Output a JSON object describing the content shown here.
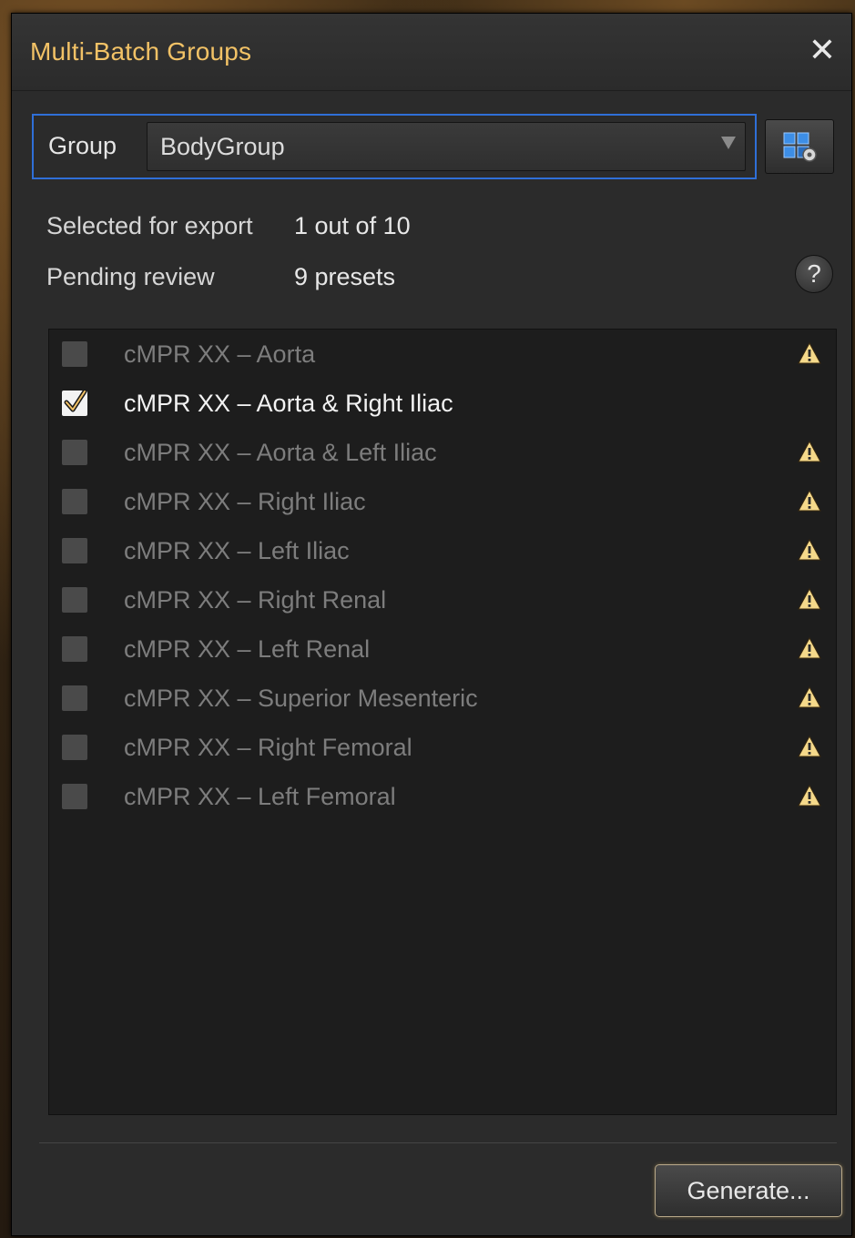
{
  "dialog": {
    "title": "Multi-Batch Groups",
    "close_glyph": "✕"
  },
  "group": {
    "label": "Group",
    "selected": "BodyGroup",
    "settings_icon": "group-settings-icon"
  },
  "info": {
    "selected_label": "Selected for export",
    "selected_value": "1 out of 10",
    "pending_label": "Pending review",
    "pending_value": "9 presets",
    "help_glyph": "?"
  },
  "presets": [
    {
      "label": "cMPR XX – Aorta",
      "checked": false,
      "warning": true
    },
    {
      "label": "cMPR XX – Aorta & Right Iliac",
      "checked": true,
      "warning": false
    },
    {
      "label": "cMPR XX – Aorta & Left Iliac",
      "checked": false,
      "warning": true
    },
    {
      "label": "cMPR XX – Right Iliac",
      "checked": false,
      "warning": true
    },
    {
      "label": "cMPR XX – Left Iliac",
      "checked": false,
      "warning": true
    },
    {
      "label": "cMPR XX – Right Renal",
      "checked": false,
      "warning": true
    },
    {
      "label": "cMPR XX – Left Renal",
      "checked": false,
      "warning": true
    },
    {
      "label": "cMPR XX – Superior Mesenteric",
      "checked": false,
      "warning": true
    },
    {
      "label": "cMPR XX – Right Femoral",
      "checked": false,
      "warning": true
    },
    {
      "label": "cMPR XX – Left Femoral",
      "checked": false,
      "warning": true
    }
  ],
  "footer": {
    "generate_label": "Generate..."
  },
  "colors": {
    "accent": "#f2c266",
    "focus_border": "#2f6fd8",
    "warning": "#f5d98a"
  }
}
